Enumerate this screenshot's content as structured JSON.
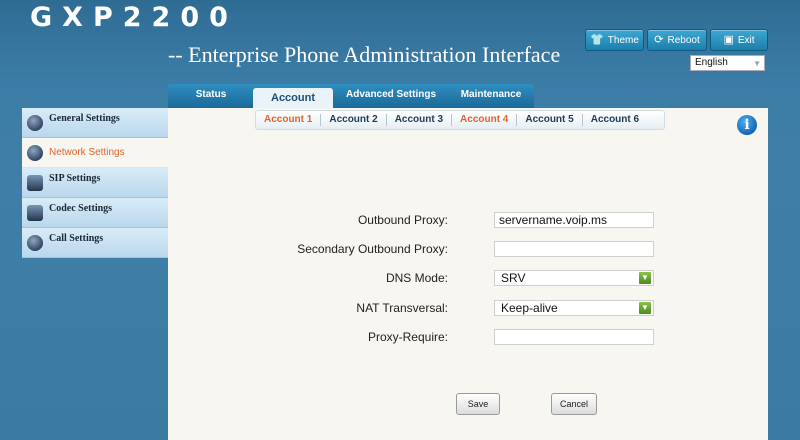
{
  "header": {
    "brand": "GXP2200",
    "subtitle": "-- Enterprise Phone Administration Interface",
    "buttons": [
      {
        "label": "Theme",
        "icon": "theme-icon"
      },
      {
        "label": "Reboot",
        "icon": "reboot-icon"
      },
      {
        "label": "Exit",
        "icon": "exit-icon"
      }
    ],
    "language": "English"
  },
  "nav": {
    "tabs": [
      {
        "label": "Status"
      },
      {
        "label": "Account"
      },
      {
        "label": "Advanced Settings"
      },
      {
        "label": "Maintenance"
      }
    ],
    "active_tab": "Account"
  },
  "subtabs": [
    {
      "label": "Account 1"
    },
    {
      "label": "Account 2"
    },
    {
      "label": "Account 3"
    },
    {
      "label": "Account 4"
    },
    {
      "label": "Account 5"
    },
    {
      "label": "Account 6"
    }
  ],
  "sidebar": {
    "items": [
      {
        "label": "General Settings",
        "icon": "general-settings-icon"
      },
      {
        "label": "Network Settings",
        "icon": "network-settings-icon"
      },
      {
        "label": "SIP Settings",
        "icon": "sip-settings-icon"
      },
      {
        "label": "Codec Settings",
        "icon": "codec-settings-icon"
      },
      {
        "label": "Call Settings",
        "icon": "call-settings-icon"
      }
    ],
    "active": "Network Settings"
  },
  "form": {
    "outbound_proxy": {
      "label": "Outbound Proxy:",
      "value": "servername.voip.ms"
    },
    "secondary_outbound_proxy": {
      "label": "Secondary Outbound Proxy:",
      "value": ""
    },
    "dns_mode": {
      "label": "DNS Mode:",
      "value": "SRV"
    },
    "nat_traversal": {
      "label": "NAT Transversal:",
      "value": "Keep-alive"
    },
    "proxy_require": {
      "label": "Proxy-Require:",
      "value": ""
    }
  },
  "actions": {
    "save_label": "Save",
    "cancel_label": "Cancel"
  },
  "colors": {
    "accent_orange": "#e0642c",
    "header_blue": "#2f6c94",
    "tab_blue": "#1a6a98"
  }
}
